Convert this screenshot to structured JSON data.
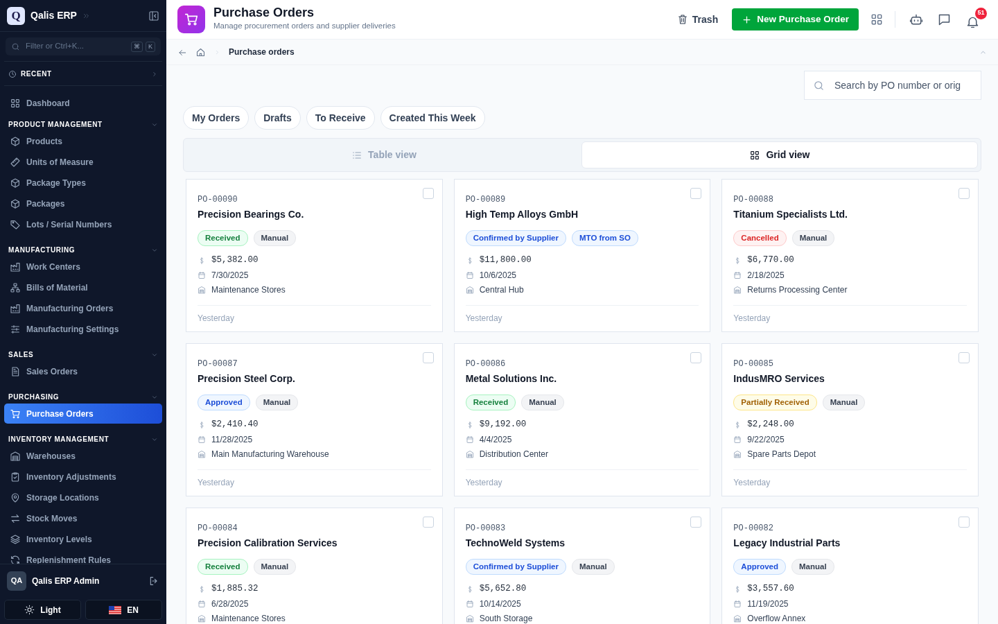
{
  "app": {
    "logo_letter": "Q",
    "name": "Qalis ERP",
    "filter_placeholder": "Filter or Ctrl+K...",
    "shortcut_keys": [
      "⌘",
      "K"
    ],
    "recent_label": "RECENT"
  },
  "sidebar": {
    "sections": [
      {
        "items": [
          {
            "label": "Dashboard",
            "selected": false
          }
        ]
      },
      {
        "title": "PRODUCT MANAGEMENT",
        "expanded": true,
        "items": [
          {
            "label": "Products",
            "selected": false
          },
          {
            "label": "Units of Measure",
            "selected": false
          },
          {
            "label": "Package Types",
            "selected": false
          },
          {
            "label": "Packages",
            "selected": false
          },
          {
            "label": "Lots / Serial Numbers",
            "selected": false
          }
        ]
      },
      {
        "title": "MANUFACTURING",
        "expanded": true,
        "items": [
          {
            "label": "Work Centers",
            "selected": false
          },
          {
            "label": "Bills of Material",
            "selected": false
          },
          {
            "label": "Manufacturing Orders",
            "selected": false
          },
          {
            "label": "Manufacturing Settings",
            "selected": false
          }
        ]
      },
      {
        "title": "SALES",
        "expanded": true,
        "items": [
          {
            "label": "Sales Orders",
            "selected": false
          }
        ]
      },
      {
        "title": "PURCHASING",
        "expanded": true,
        "items": [
          {
            "label": "Purchase Orders",
            "selected": true
          }
        ]
      },
      {
        "title": "INVENTORY MANAGEMENT",
        "expanded": true,
        "items": [
          {
            "label": "Warehouses",
            "selected": false
          },
          {
            "label": "Inventory Adjustments",
            "selected": false
          },
          {
            "label": "Storage Locations",
            "selected": false
          },
          {
            "label": "Stock Moves",
            "selected": false
          },
          {
            "label": "Inventory Levels",
            "selected": false
          },
          {
            "label": "Replenishment Rules",
            "selected": false
          }
        ]
      }
    ]
  },
  "user": {
    "initials": "QA",
    "name": "Qalis ERP Admin"
  },
  "footer_buttons": [
    {
      "label": "Light"
    },
    {
      "label": "EN"
    }
  ],
  "header": {
    "title": "Purchase Orders",
    "subtitle": "Manage procurement orders and supplier deliveries",
    "trash_label": "Trash",
    "new_button": "New Purchase Order",
    "notification_count": "51"
  },
  "breadcrumb": {
    "current": "Purchase orders"
  },
  "search": {
    "placeholder": "Search by PO number or orig"
  },
  "filters": [
    {
      "label": "My Orders"
    },
    {
      "label": "Drafts"
    },
    {
      "label": "To Receive"
    },
    {
      "label": "Created This Week"
    }
  ],
  "views": [
    {
      "label": "Table view",
      "selected": false
    },
    {
      "label": "Grid view",
      "selected": true
    }
  ],
  "orders": [
    {
      "number": "PO-00090",
      "supplier": "Precision Bearings Co.",
      "tags": [
        {
          "label": "Received",
          "kind": "success"
        },
        {
          "label": "Manual",
          "kind": "neutral"
        }
      ],
      "amount": "$5,382.00",
      "date": "7/30/2025",
      "location": "Maintenance Stores",
      "updated": "Yesterday",
      "checked": false
    },
    {
      "number": "PO-00089",
      "supplier": "High Temp Alloys GmbH",
      "tags": [
        {
          "label": "Confirmed by Supplier",
          "kind": "info"
        },
        {
          "label": "MTO from SO",
          "kind": "info"
        }
      ],
      "amount": "$11,800.00",
      "date": "10/6/2025",
      "location": "Central Hub",
      "updated": "Yesterday",
      "checked": false
    },
    {
      "number": "PO-00088",
      "supplier": "Titanium Specialists Ltd.",
      "tags": [
        {
          "label": "Cancelled",
          "kind": "danger"
        },
        {
          "label": "Manual",
          "kind": "neutral"
        }
      ],
      "amount": "$6,770.00",
      "date": "2/18/2025",
      "location": "Returns Processing Center",
      "updated": "Yesterday",
      "checked": false
    },
    {
      "number": "PO-00087",
      "supplier": "Precision Steel Corp.",
      "tags": [
        {
          "label": "Approved",
          "kind": "info"
        },
        {
          "label": "Manual",
          "kind": "neutral"
        }
      ],
      "amount": "$2,410.40",
      "date": "11/28/2025",
      "location": "Main Manufacturing Warehouse",
      "updated": "Yesterday",
      "checked": false
    },
    {
      "number": "PO-00086",
      "supplier": "Metal Solutions Inc.",
      "tags": [
        {
          "label": "Received",
          "kind": "success"
        },
        {
          "label": "Manual",
          "kind": "neutral"
        }
      ],
      "amount": "$9,192.00",
      "date": "4/4/2025",
      "location": "Distribution Center",
      "updated": "Yesterday",
      "checked": false
    },
    {
      "number": "PO-00085",
      "supplier": "IndusMRO Services",
      "tags": [
        {
          "label": "Partially Received",
          "kind": "warning"
        },
        {
          "label": "Manual",
          "kind": "neutral"
        }
      ],
      "amount": "$2,248.00",
      "date": "9/22/2025",
      "location": "Spare Parts Depot",
      "updated": "Yesterday",
      "checked": false
    },
    {
      "number": "PO-00084",
      "supplier": "Precision Calibration Services",
      "tags": [
        {
          "label": "Received",
          "kind": "success"
        },
        {
          "label": "Manual",
          "kind": "neutral"
        }
      ],
      "amount": "$1,885.32",
      "date": "6/28/2025",
      "location": "Maintenance Stores",
      "checked": false
    },
    {
      "number": "PO-00083",
      "supplier": "TechnoWeld Systems",
      "tags": [
        {
          "label": "Confirmed by Supplier",
          "kind": "info"
        },
        {
          "label": "Manual",
          "kind": "neutral"
        }
      ],
      "amount": "$5,652.80",
      "date": "10/14/2025",
      "location": "South Storage",
      "checked": false
    },
    {
      "number": "PO-00082",
      "supplier": "Legacy Industrial Parts",
      "tags": [
        {
          "label": "Approved",
          "kind": "info"
        },
        {
          "label": "Manual",
          "kind": "neutral"
        }
      ],
      "amount": "$3,557.60",
      "date": "11/19/2025",
      "location": "Overflow Annex",
      "checked": false
    }
  ]
}
